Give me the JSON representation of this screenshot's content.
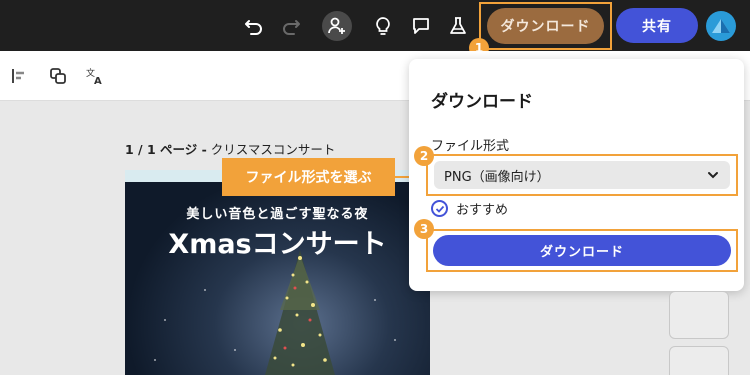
{
  "colors": {
    "topbar": "#1f1f1f",
    "accent_orange": "#f2a23a",
    "primary_blue": "#4353d8"
  },
  "topbar": {
    "icons": [
      "undo-icon",
      "redo-icon",
      "add-user-icon",
      "lightbulb-icon",
      "comment-icon",
      "flask-icon"
    ],
    "download_label": "ダウンロード",
    "share_label": "共有"
  },
  "toolbar": {
    "icons": [
      "align-left-icon",
      "copy-style-icon",
      "translate-icon"
    ]
  },
  "page": {
    "counter": "1 / 1 ページ -",
    "name": "クリスマスコンサート"
  },
  "design": {
    "subtitle": "美しい音色と過ごす聖なる夜",
    "title": "Xmasコンサート"
  },
  "callout": {
    "text": "ファイル形式を選ぶ"
  },
  "badges": {
    "one": "1",
    "two": "2",
    "three": "3"
  },
  "download_panel": {
    "title": "ダウンロード",
    "file_type_label": "ファイル形式",
    "file_type_value": "PNG（画像向け）",
    "recommended_label": "おすすめ",
    "download_button": "ダウンロード"
  }
}
